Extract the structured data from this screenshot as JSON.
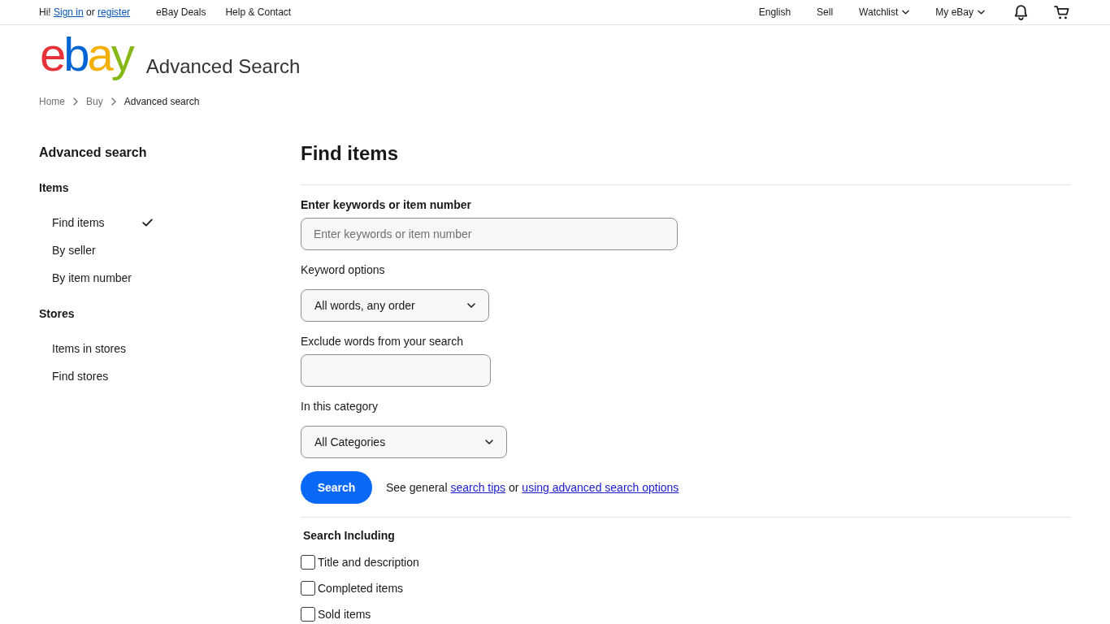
{
  "top_nav": {
    "greeting": {
      "hello": "Hi!",
      "sign_in": "Sign in",
      "or": "or",
      "register": "register"
    },
    "left_links": [
      "eBay Deals",
      "Help & Contact"
    ],
    "right_links": [
      {
        "label": "English",
        "kind": "link"
      },
      {
        "label": "Sell",
        "kind": "link"
      },
      {
        "label": "Watchlist",
        "kind": "menu"
      },
      {
        "label": "My eBay",
        "kind": "menu"
      }
    ]
  },
  "header": {
    "logo": "ebay",
    "title": "Advanced Search"
  },
  "breadcrumb": [
    {
      "label": "Home",
      "current": false
    },
    {
      "label": "Buy",
      "current": false
    },
    {
      "label": "Advanced search",
      "current": true
    }
  ],
  "sidebar": {
    "title": "Advanced search",
    "groups": [
      {
        "heading": "Items",
        "items": [
          {
            "label": "Find items",
            "selected": true
          },
          {
            "label": "By seller",
            "selected": false
          },
          {
            "label": "By item number",
            "selected": false
          }
        ]
      },
      {
        "heading": "Stores",
        "items": [
          {
            "label": "Items in stores",
            "selected": false
          },
          {
            "label": "Find stores",
            "selected": false
          }
        ]
      }
    ]
  },
  "main": {
    "title": "Find items",
    "fields": [
      {
        "kind": "text",
        "label": "Enter keywords or item number",
        "bold": true,
        "placeholder": "Enter keywords or item number"
      },
      {
        "kind": "select",
        "label": "Keyword options",
        "bold": false,
        "value": "All words, any order"
      },
      {
        "kind": "text",
        "label": "Exclude words from your search",
        "bold": false
      },
      {
        "kind": "select",
        "label": "In this category",
        "bold": false,
        "value": "All Categories"
      }
    ],
    "search_button": "Search",
    "help": {
      "prefix": "See general",
      "tips_link": "search tips",
      "or": "or",
      "options_link": "using advanced search options"
    },
    "search_including": {
      "heading": "Search Including",
      "options": [
        {
          "label": "Title and description",
          "checked": false
        },
        {
          "label": "Completed items",
          "checked": false
        },
        {
          "label": "Sold items",
          "checked": false
        }
      ]
    }
  }
}
